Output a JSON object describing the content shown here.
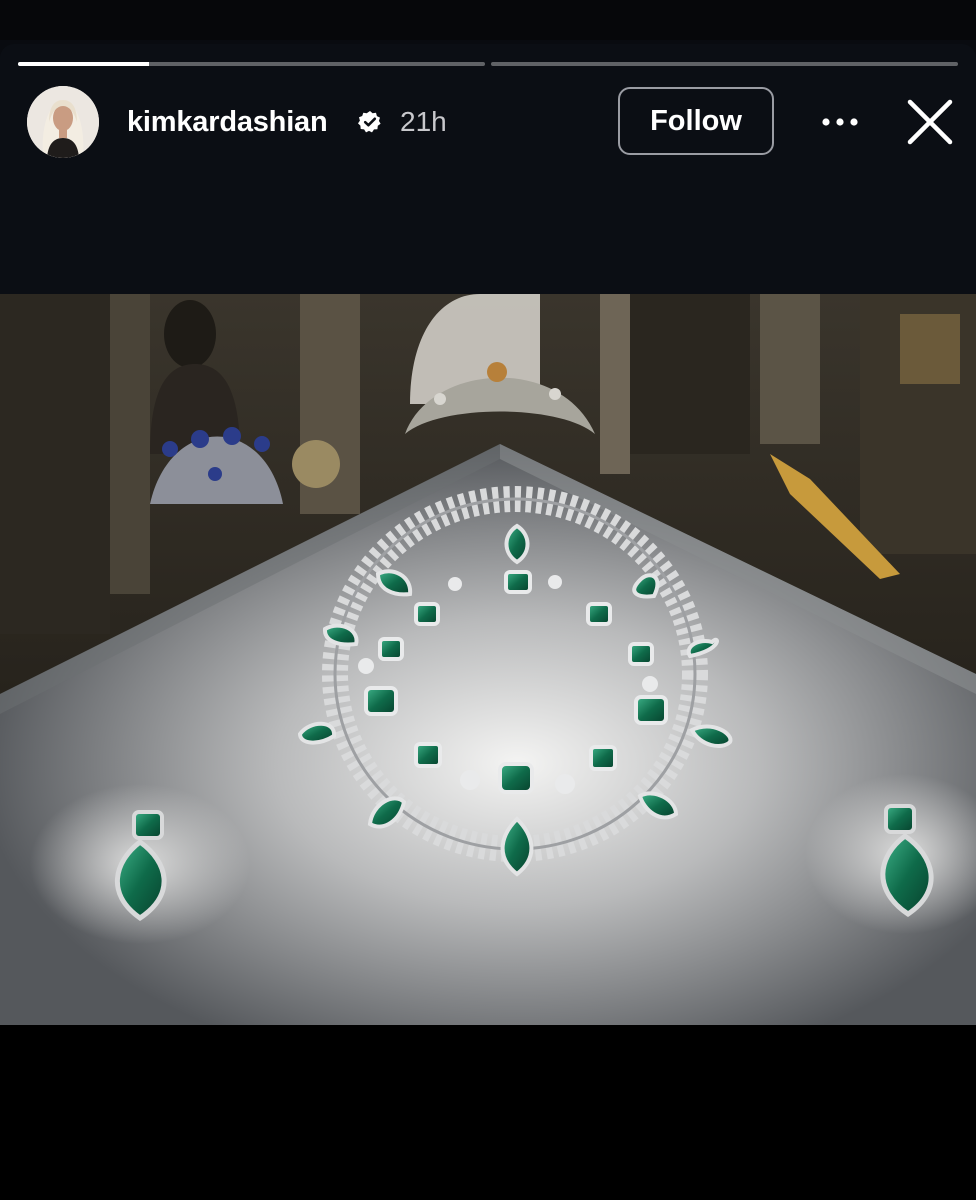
{
  "story": {
    "progress": [
      {
        "segment": 1,
        "fraction": 0.28
      },
      {
        "segment": 2,
        "fraction": 0.0
      }
    ],
    "header": {
      "username": "kimkardashian",
      "verified": true,
      "time_ago": "21h",
      "follow_label": "Follow",
      "more_icon": "more-horizontal-icon",
      "close_icon": "close-icon",
      "avatar_icon": "profile-avatar"
    }
  },
  "colors": {
    "background": "#000000",
    "header_background": "#0b0e14",
    "follow_border": "#9a9ca3",
    "text_primary": "#ffffff",
    "text_secondary": "#c8c8cc",
    "emerald": "#0f6b4a"
  }
}
